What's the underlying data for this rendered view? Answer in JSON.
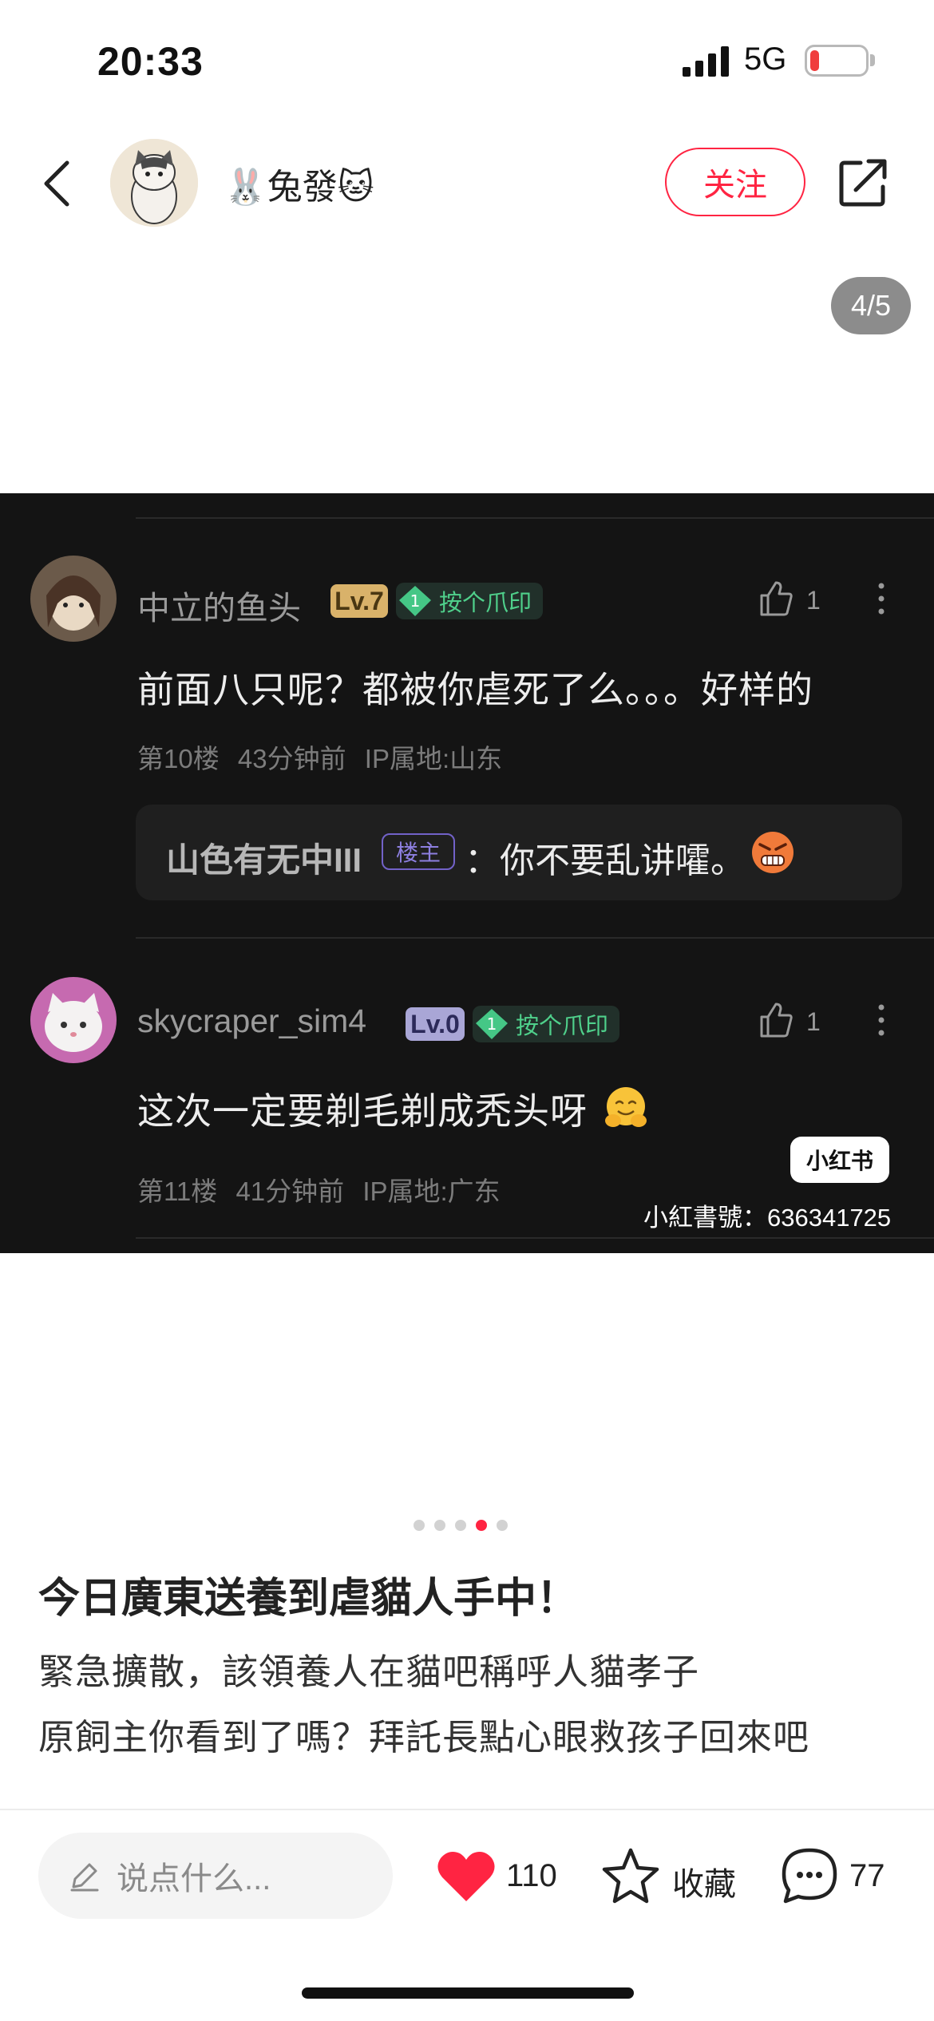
{
  "status_bar": {
    "time": "20:33",
    "network": "5G",
    "battery_level": 0.15
  },
  "header": {
    "username": "🐰兔發🐱",
    "follow_label": "关注",
    "image_counter": "4/5"
  },
  "image": {
    "comments": [
      {
        "name": "中立的鱼头",
        "level": "Lv.7",
        "level_color": "#d9b26a",
        "badge_num": "1",
        "badge": "按个爪印",
        "likes": "1",
        "text": "前面八只呢？都被你虐死了么。。。好样的",
        "floor": "第10楼",
        "time": "43分钟前",
        "ip": "IP属地:山东",
        "reply": {
          "author": "山色有无中III",
          "tag": "楼主",
          "text": "：你不要乱讲嚯。"
        }
      },
      {
        "name": "skycraper_sim4",
        "level": "Lv.0",
        "level_color": "#a9a6d6",
        "badge_num": "1",
        "badge": "按个爪印",
        "likes": "1",
        "text": "这次一定要剃毛剃成秃头呀",
        "floor": "第11楼",
        "time": "41分钟前",
        "ip": "IP属地:广东"
      }
    ],
    "watermark_logo": "小红书",
    "watermark_id": "小紅書號：636341725"
  },
  "pager": {
    "total": 5,
    "current": 4
  },
  "post": {
    "title": "今日廣東送養到虐貓人手中！",
    "body_lines": [
      "緊急擴散，該領養人在貓吧稱呼人貓孝子",
      "原飼主你看到了嗎？拜託長點心眼救孩子回來吧"
    ]
  },
  "bottom_bar": {
    "comment_placeholder": "说点什么...",
    "likes": "110",
    "favorite_label": "收藏",
    "comments": "77"
  },
  "colors": {
    "accent": "#ff2442",
    "badge_green": "#4fd08b"
  }
}
